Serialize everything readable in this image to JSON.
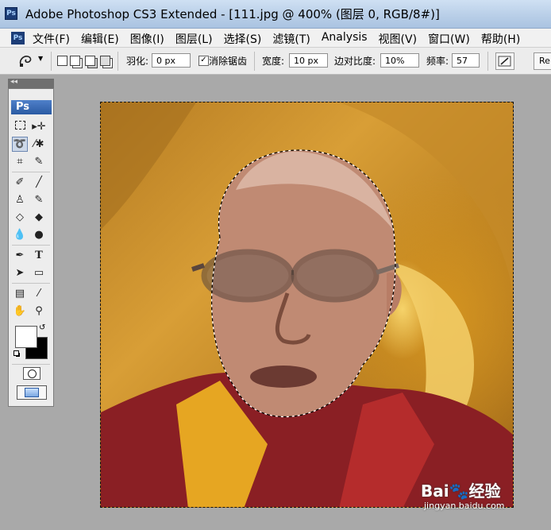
{
  "titlebar": {
    "icon": "Ps",
    "title": "Adobe Photoshop CS3 Extended - [111.jpg @ 400% (图层 0, RGB/8#)]"
  },
  "menubar": {
    "icon": "Ps",
    "items": [
      "文件(F)",
      "编辑(E)",
      "图像(I)",
      "图层(L)",
      "选择(S)",
      "滤镜(T)",
      "Analysis",
      "视图(V)",
      "窗口(W)",
      "帮助(H)"
    ]
  },
  "options": {
    "feather_label": "羽化:",
    "feather_value": "0 px",
    "antialias_label": "消除锯齿",
    "antialias_checked": true,
    "width_label": "宽度:",
    "width_value": "10 px",
    "contrast_label": "边对比度:",
    "contrast_value": "10%",
    "frequency_label": "频率:",
    "frequency_value": "57",
    "refine_edge_label": "Re"
  },
  "toolbox": {
    "logo": "Ps",
    "collapse_arrows": "◂◂"
  },
  "colors": {
    "foreground": "#ffffff",
    "background": "#000000",
    "accent": "#2a5aa3"
  },
  "watermark": {
    "brand": "Bai",
    "suffix": "经验",
    "url": "jingyan.baidu.com"
  }
}
